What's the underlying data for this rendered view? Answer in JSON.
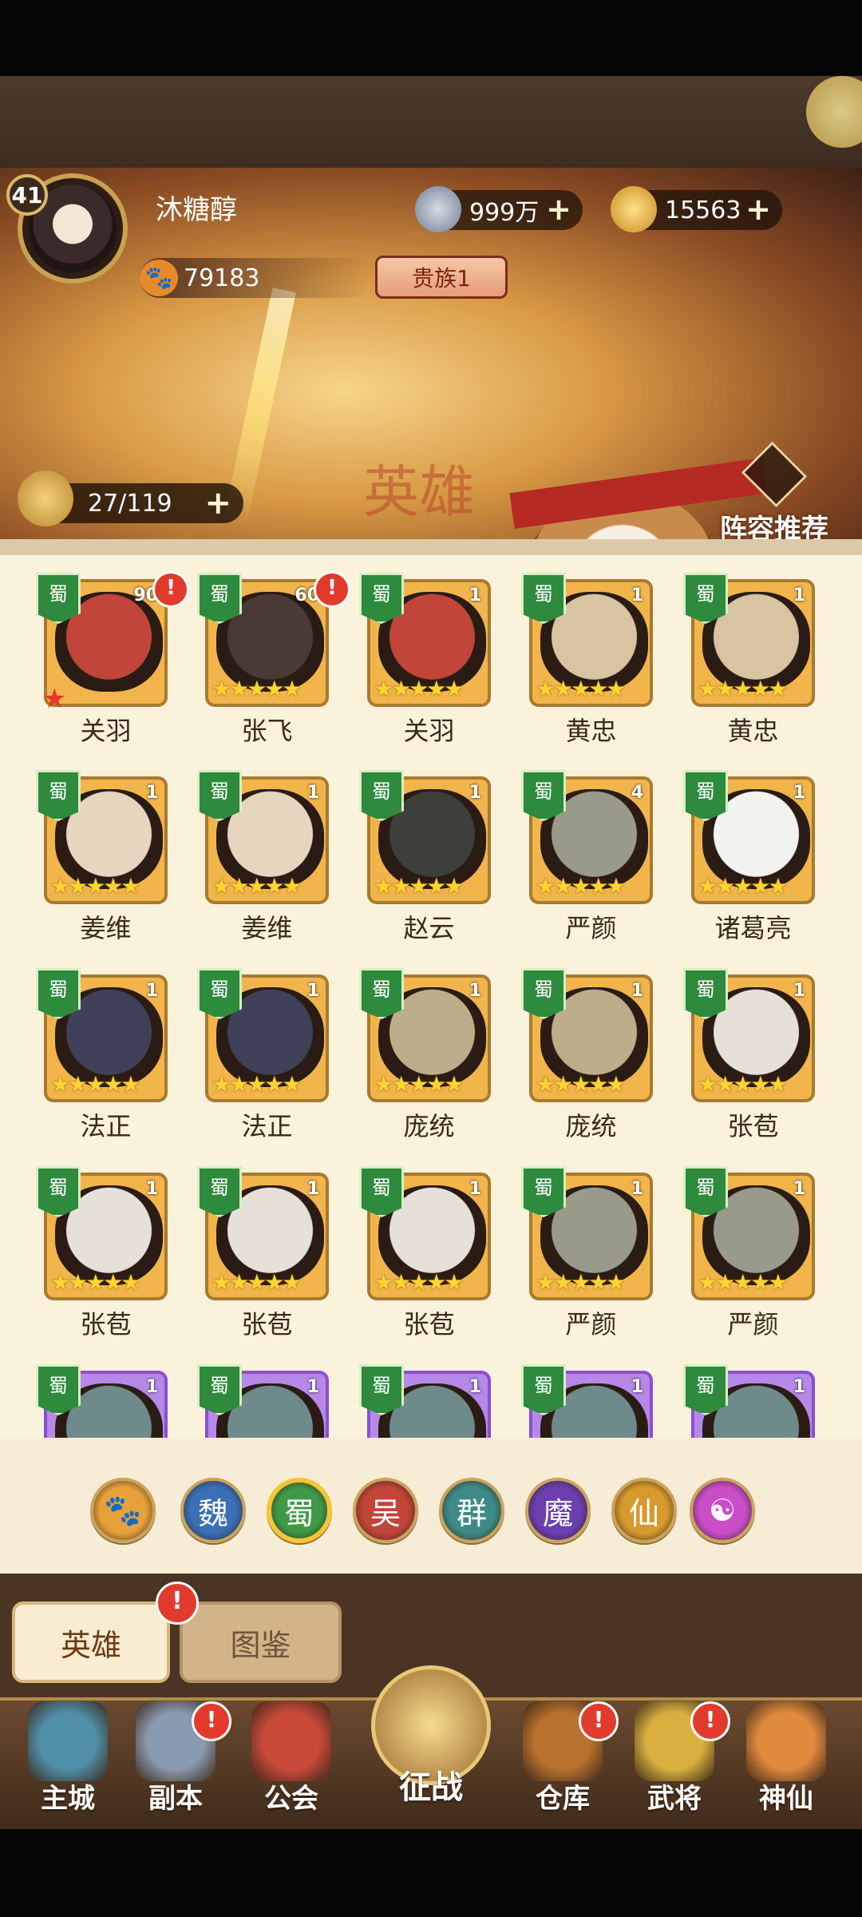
{
  "player": {
    "level": "41",
    "name": "沐糖醇",
    "coins": "999万",
    "gold": "15563",
    "paw_points": "79183",
    "noble_rank": "贵族1"
  },
  "banner": {
    "watermark": "英雄",
    "roster_count": "27/119",
    "formation_label": "阵容推荐"
  },
  "heroes": [
    {
      "faction": "蜀",
      "name": "关羽",
      "count": "90",
      "alert": true,
      "stars": "",
      "red_star": true,
      "frame": "gold",
      "face": "#c2453a"
    },
    {
      "faction": "蜀",
      "name": "张飞",
      "count": "60",
      "alert": true,
      "stars": "★★★★★",
      "red_star": false,
      "frame": "gold",
      "face": "#4a3a36"
    },
    {
      "faction": "蜀",
      "name": "关羽",
      "count": "1",
      "alert": false,
      "stars": "★★★★★",
      "red_star": false,
      "frame": "gold",
      "face": "#c2453a"
    },
    {
      "faction": "蜀",
      "name": "黄忠",
      "count": "1",
      "alert": false,
      "stars": "★★★★★",
      "red_star": false,
      "frame": "gold",
      "face": "#d9c4a2"
    },
    {
      "faction": "蜀",
      "name": "黄忠",
      "count": "1",
      "alert": false,
      "stars": "★★★★★",
      "red_star": false,
      "frame": "gold",
      "face": "#d9c4a2"
    },
    {
      "faction": "蜀",
      "name": "姜维",
      "count": "1",
      "alert": false,
      "stars": "★★★★★",
      "red_star": false,
      "frame": "gold",
      "face": "#e6d6c0"
    },
    {
      "faction": "蜀",
      "name": "姜维",
      "count": "1",
      "alert": false,
      "stars": "★★★★★",
      "red_star": false,
      "frame": "gold",
      "face": "#e6d6c0"
    },
    {
      "faction": "蜀",
      "name": "赵云",
      "count": "1",
      "alert": false,
      "stars": "★★★★★",
      "red_star": false,
      "frame": "gold",
      "face": "#3d3f3a"
    },
    {
      "faction": "蜀",
      "name": "严颜",
      "count": "4",
      "alert": false,
      "stars": "★★★★★",
      "red_star": false,
      "frame": "gold",
      "face": "#9a9a8a"
    },
    {
      "faction": "蜀",
      "name": "诸葛亮",
      "count": "1",
      "alert": false,
      "stars": "★★★★★",
      "red_star": false,
      "frame": "gold",
      "face": "#f2f2ee"
    },
    {
      "faction": "蜀",
      "name": "法正",
      "count": "1",
      "alert": false,
      "stars": "★★★★★",
      "red_star": false,
      "frame": "gold",
      "face": "#3e4157"
    },
    {
      "faction": "蜀",
      "name": "法正",
      "count": "1",
      "alert": false,
      "stars": "★★★★★",
      "red_star": false,
      "frame": "gold",
      "face": "#3e4157"
    },
    {
      "faction": "蜀",
      "name": "庞统",
      "count": "1",
      "alert": false,
      "stars": "★★★★★",
      "red_star": false,
      "frame": "gold",
      "face": "#bcae8a"
    },
    {
      "faction": "蜀",
      "name": "庞统",
      "count": "1",
      "alert": false,
      "stars": "★★★★★",
      "red_star": false,
      "frame": "gold",
      "face": "#bcae8a"
    },
    {
      "faction": "蜀",
      "name": "张苞",
      "count": "1",
      "alert": false,
      "stars": "★★★★★",
      "red_star": false,
      "frame": "gold",
      "face": "#e6e0d8"
    },
    {
      "faction": "蜀",
      "name": "张苞",
      "count": "1",
      "alert": false,
      "stars": "★★★★★",
      "red_star": false,
      "frame": "gold",
      "face": "#e6e0d8"
    },
    {
      "faction": "蜀",
      "name": "张苞",
      "count": "1",
      "alert": false,
      "stars": "★★★★★",
      "red_star": false,
      "frame": "gold",
      "face": "#e6e0d8"
    },
    {
      "faction": "蜀",
      "name": "张苞",
      "count": "1",
      "alert": false,
      "stars": "★★★★★",
      "red_star": false,
      "frame": "gold",
      "face": "#e6e0d8"
    },
    {
      "faction": "蜀",
      "name": "严颜",
      "count": "1",
      "alert": false,
      "stars": "★★★★★",
      "red_star": false,
      "frame": "gold",
      "face": "#9a9a8a"
    },
    {
      "faction": "蜀",
      "name": "严颜",
      "count": "1",
      "alert": false,
      "stars": "★★★★★",
      "red_star": false,
      "frame": "gold",
      "face": "#9a9a8a"
    },
    {
      "faction": "蜀",
      "name": "",
      "count": "1",
      "alert": false,
      "stars": "",
      "red_star": false,
      "frame": "purple",
      "face": "#6f8a8a"
    },
    {
      "faction": "蜀",
      "name": "",
      "count": "1",
      "alert": false,
      "stars": "",
      "red_star": false,
      "frame": "purple",
      "face": "#6f8a8a"
    },
    {
      "faction": "蜀",
      "name": "",
      "count": "1",
      "alert": false,
      "stars": "",
      "red_star": false,
      "frame": "purple",
      "face": "#6f8a8a"
    },
    {
      "faction": "蜀",
      "name": "",
      "count": "1",
      "alert": false,
      "stars": "",
      "red_star": false,
      "frame": "purple",
      "face": "#6f8a8a"
    },
    {
      "faction": "蜀",
      "name": "",
      "count": "1",
      "alert": false,
      "stars": "",
      "red_star": false,
      "frame": "purple",
      "face": "#6f8a8a"
    }
  ],
  "factions": [
    {
      "label": "🐾",
      "color": "#e8a13a",
      "selected": false
    },
    {
      "label": "魏",
      "color": "#3b6fb6",
      "selected": false
    },
    {
      "label": "蜀",
      "color": "#3f9a48",
      "selected": true
    },
    {
      "label": "吴",
      "color": "#c2453a",
      "selected": false
    },
    {
      "label": "群",
      "color": "#3f8a86",
      "selected": false
    },
    {
      "label": "魔",
      "color": "#6b3fb0",
      "selected": false
    },
    {
      "label": "仙",
      "color": "#d79a2e",
      "selected": false
    },
    {
      "label": "☯",
      "color": "#c84fc7",
      "selected": false
    }
  ],
  "tabs": {
    "active": "英雄",
    "inactive": "图鉴",
    "alert": "!"
  },
  "nav": [
    {
      "label": "主城",
      "icon": "castle-icon",
      "alert": false,
      "color": "#4f8fa8"
    },
    {
      "label": "副本",
      "icon": "sword-icon",
      "alert": true,
      "color": "#8a9ab0"
    },
    {
      "label": "公会",
      "icon": "flag-icon",
      "alert": false,
      "color": "#c94a3a"
    },
    {
      "label": "仓库",
      "icon": "bag-icon",
      "alert": true,
      "color": "#b8722e"
    },
    {
      "label": "武将",
      "icon": "cat-icon",
      "alert": true,
      "color": "#d9b040"
    },
    {
      "label": "神仙",
      "icon": "immortal-icon",
      "alert": false,
      "color": "#e08a3e"
    }
  ],
  "center_nav": {
    "label": "征战",
    "icon": "battle-icon"
  }
}
